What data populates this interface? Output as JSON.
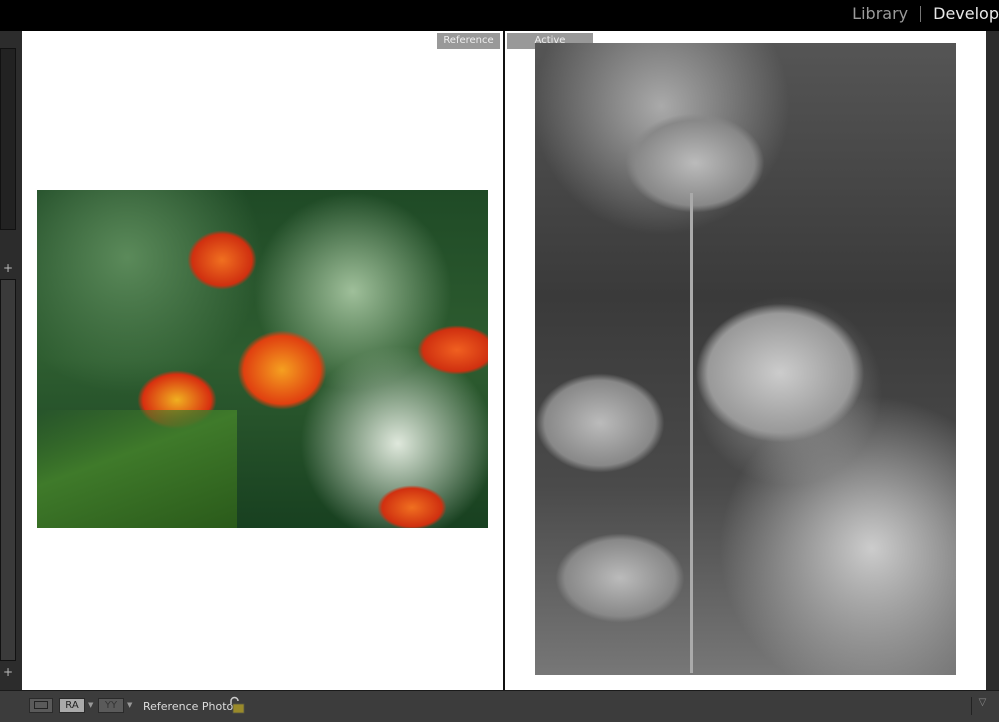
{
  "header": {
    "modules": [
      {
        "label": "Library",
        "active": false
      },
      {
        "label": "Develop",
        "active": true
      }
    ]
  },
  "compare": {
    "reference_label": "Reference",
    "active_label": "Active"
  },
  "toolbar": {
    "view_icon": "loupe-view-icon",
    "ra_label": "RA",
    "yy_label": "YY",
    "reference_photo_label": "Reference Photo :",
    "lock_icon": "unlocked-padlock-icon",
    "menu_icon": "chevron-down-icon"
  },
  "colors": {
    "lock": "#9a8a2a",
    "tag_bg": "#999999",
    "toolbar_bg": "#3c3c3c"
  }
}
